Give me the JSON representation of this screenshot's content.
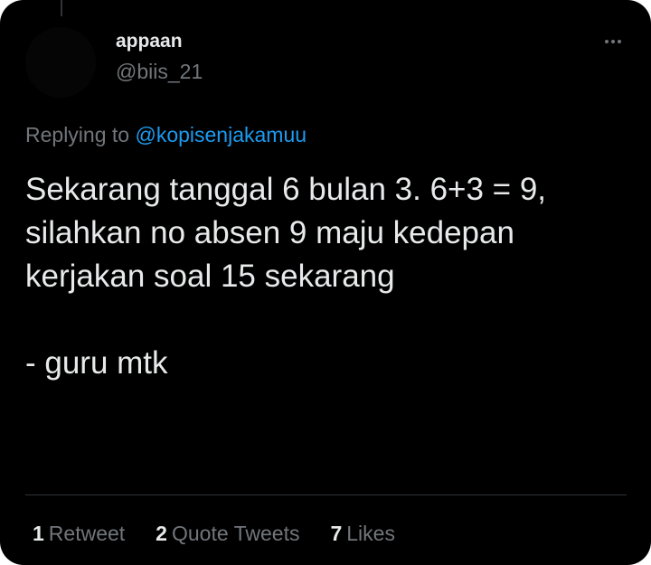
{
  "tweet": {
    "author": {
      "display_name": "appaan",
      "handle": "@biis_21"
    },
    "reply": {
      "prefix": "Replying to",
      "mention": "@kopisenjakamuu"
    },
    "text_lines": [
      "Sekarang tanggal 6 bulan 3. 6+3 = 9,",
      "silahkan no absen 9 maju kedepan",
      "kerjakan soal 15 sekarang",
      "- guru mtk"
    ],
    "stats": {
      "retweets": {
        "count": "1",
        "label": "Retweet"
      },
      "quotes": {
        "count": "2",
        "label": "Quote Tweets"
      },
      "likes": {
        "count": "7",
        "label": "Likes"
      }
    }
  },
  "colors": {
    "background": "#000000",
    "text": "#e7e9ea",
    "secondary": "#71767b",
    "accent": "#1d9bf0",
    "divider": "#2f3336"
  },
  "icons": {
    "more": "more-horizontal-icon"
  }
}
